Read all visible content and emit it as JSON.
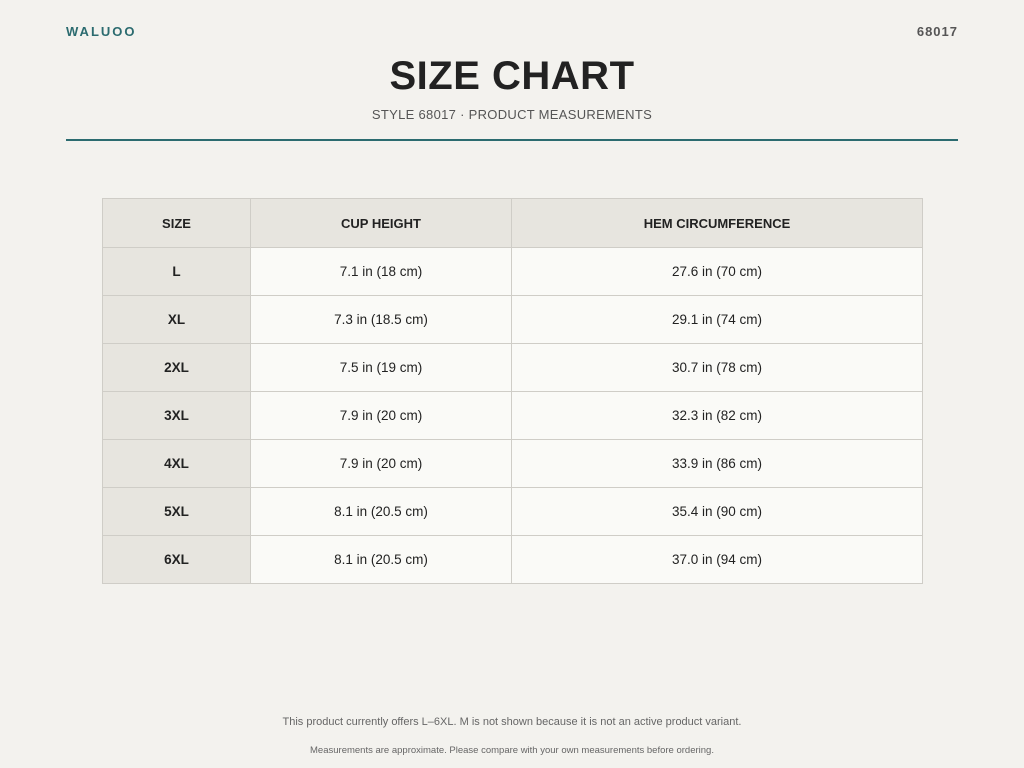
{
  "header": {
    "brand": "WALUOO",
    "style_code": "68017",
    "title": "SIZE CHART",
    "subtitle": "STYLE 68017 · PRODUCT MEASUREMENTS"
  },
  "table": {
    "headers": [
      "SIZE",
      "CUP HEIGHT",
      "HEM CIRCUMFERENCE"
    ],
    "rows": [
      {
        "size": "L",
        "cup_height": "7.1 in (18 cm)",
        "hem": "27.6 in (70 cm)"
      },
      {
        "size": "XL",
        "cup_height": "7.3 in (18.5 cm)",
        "hem": "29.1 in (74 cm)"
      },
      {
        "size": "2XL",
        "cup_height": "7.5 in (19 cm)",
        "hem": "30.7 in (78 cm)"
      },
      {
        "size": "3XL",
        "cup_height": "7.9 in (20 cm)",
        "hem": "32.3 in (82 cm)"
      },
      {
        "size": "4XL",
        "cup_height": "7.9 in (20 cm)",
        "hem": "33.9 in (86 cm)"
      },
      {
        "size": "5XL",
        "cup_height": "8.1 in (20.5 cm)",
        "hem": "35.4 in (90 cm)"
      },
      {
        "size": "6XL",
        "cup_height": "8.1 in (20.5 cm)",
        "hem": "37.0 in (94 cm)"
      }
    ]
  },
  "footer": {
    "availability_note": "This product currently offers L–6XL. M is not shown because it is not an active product variant.",
    "disclaimer": "Measurements are approximate. Please compare with your own measurements before ordering."
  },
  "colors": {
    "accent": "#2b6b6f",
    "background": "#f3f2ee",
    "header_cell": "#e7e5df",
    "value_cell": "#fafaf7"
  }
}
